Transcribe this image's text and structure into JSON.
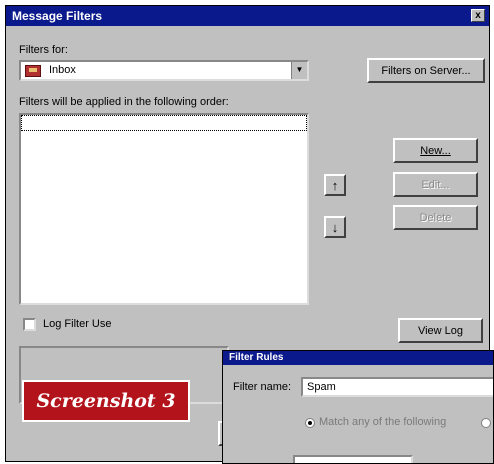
{
  "window": {
    "title": "Message Filters",
    "close_glyph": "x"
  },
  "filters_for": {
    "label": "Filters for:",
    "selected": "Inbox",
    "icon": "inbox-icon",
    "server_button": "Filters on Server..."
  },
  "order_label": "Filters will be applied in the following order:",
  "buttons": {
    "new": "New...",
    "edit": "Edit...",
    "delete": "Delete",
    "up_glyph": "↑",
    "down_glyph": "↓",
    "view_log": "View Log"
  },
  "log_filter_use": {
    "label": "Log Filter Use",
    "checked": false
  },
  "sub_dialog": {
    "title": "Filter Rules",
    "filter_name_label": "Filter name:",
    "filter_name_value": "Spam",
    "match_any_label": "Match any of the following",
    "match_any_selected": true
  },
  "caption": "Screenshot 3"
}
